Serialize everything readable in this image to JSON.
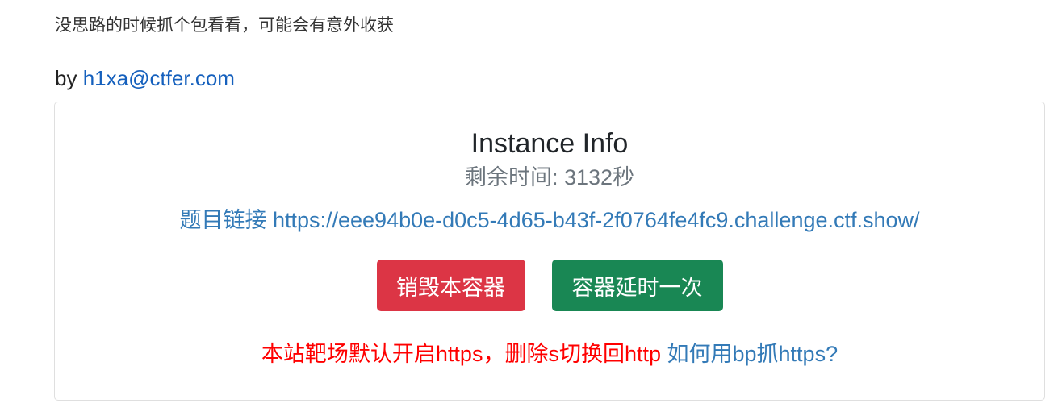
{
  "description": {
    "hint": "没思路的时候抓个包看看，可能会有意外收获",
    "author_prefix": "by ",
    "author_email": "h1xa@ctfer.com"
  },
  "instance": {
    "title": "Instance Info",
    "remaining_label": "剩余时间: 3132秒",
    "link_label": "题目链接 ",
    "link_url": "https://eee94b0e-d0c5-4d65-b43f-2f0764fe4fc9.challenge.ctf.show/",
    "destroy_button": "销毁本容器",
    "extend_button": "容器延时一次",
    "notice": "本站靶场默认开启https，删除s切换回http",
    "help_link": "如何用bp抓https?"
  },
  "colors": {
    "link": "#337ab7",
    "author_link": "#1560bd",
    "destroy": "#dc3545",
    "extend": "#198754",
    "notice": "#ff0000"
  }
}
